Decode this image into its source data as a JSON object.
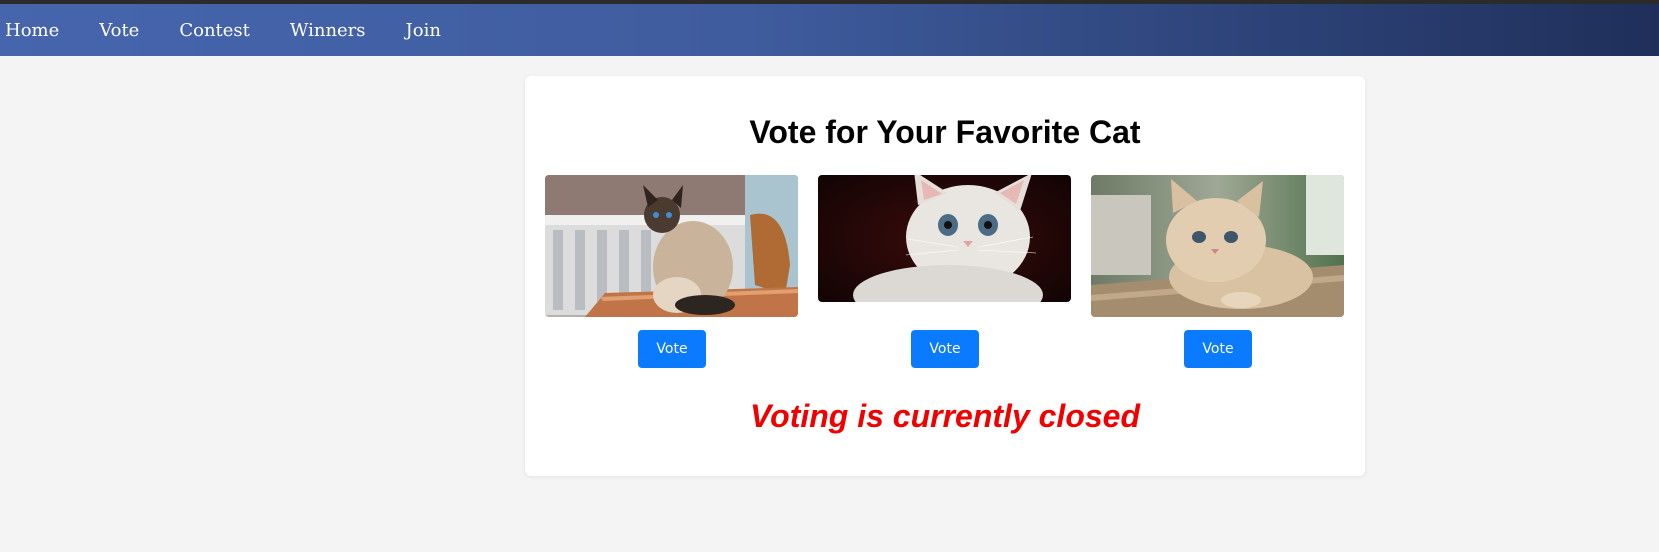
{
  "nav": {
    "items": [
      {
        "label": "Home"
      },
      {
        "label": "Vote"
      },
      {
        "label": "Contest"
      },
      {
        "label": "Winners"
      },
      {
        "label": "Join"
      }
    ]
  },
  "main": {
    "title": "Vote for Your Favorite Cat",
    "cats": [
      {
        "image": "siamese cat sitting on wooden table on a porch",
        "vote_label": "Vote"
      },
      {
        "image": "white kitten with blue eyes on dark background",
        "vote_label": "Vote"
      },
      {
        "image": "fluffy cream kitten lying on wooden surface",
        "vote_label": "Vote"
      }
    ],
    "status": "Voting is currently closed"
  },
  "colors": {
    "nav_start": "#4665ad",
    "nav_end": "#1f2f5a",
    "button": "#0a7bff",
    "status": "#f20000",
    "background": "#f4f4f4"
  }
}
